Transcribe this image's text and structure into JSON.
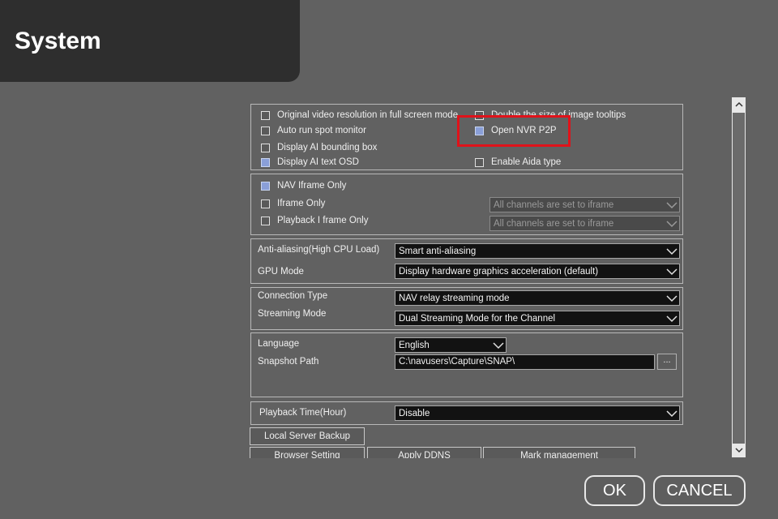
{
  "header": {
    "title": "System"
  },
  "display_options": {
    "left": [
      {
        "label": "Original video resolution in full screen mode",
        "checked": false
      },
      {
        "label": "Auto run spot monitor",
        "checked": false
      },
      {
        "label": "Display AI bounding box",
        "checked": false
      },
      {
        "label": "Display AI text OSD",
        "checked": true
      }
    ],
    "right": [
      {
        "label": "Double the size of image tooltips",
        "checked": false
      },
      {
        "label": "Open NVR P2P",
        "checked": true
      },
      {
        "label": "Enable Aida type",
        "checked": false
      }
    ]
  },
  "iframe": {
    "nav_iframe_only": {
      "label": "NAV Iframe Only",
      "checked": true
    },
    "iframe_only": {
      "label": "Iframe Only",
      "checked": false,
      "select": "All channels are set to iframe"
    },
    "playback_iframe_only": {
      "label": "Playback I frame Only",
      "checked": false,
      "select": "All channels are set to iframe"
    }
  },
  "render": {
    "anti_aliasing_label": "Anti-aliasing(High CPU Load)",
    "anti_aliasing_value": "Smart anti-aliasing",
    "gpu_mode_label": "GPU Mode",
    "gpu_mode_value": "Display hardware graphics acceleration (default)"
  },
  "connection": {
    "connection_type_label": "Connection Type",
    "connection_type_value": "NAV relay streaming mode",
    "streaming_mode_label": "Streaming Mode",
    "streaming_mode_value": "Dual Streaming Mode for the Channel"
  },
  "general": {
    "language_label": "Language",
    "language_value": "English",
    "snapshot_label": "Snapshot Path",
    "snapshot_value": "C:\\navusers\\Capture\\SNAP\\",
    "browse_label": "..."
  },
  "playback": {
    "time_label": "Playback Time(Hour)",
    "time_value": "Disable"
  },
  "buttons": {
    "local_server_backup": "Local Server Backup",
    "browser_setting": "Browser Setting",
    "apply_ddns": "Apply DDNS",
    "mark_management": "Mark management"
  },
  "footer": {
    "ok": "OK",
    "cancel": "CANCEL"
  },
  "colors": {
    "highlight_box": "#e0121a",
    "checked_fill": "#8a9fd8"
  }
}
